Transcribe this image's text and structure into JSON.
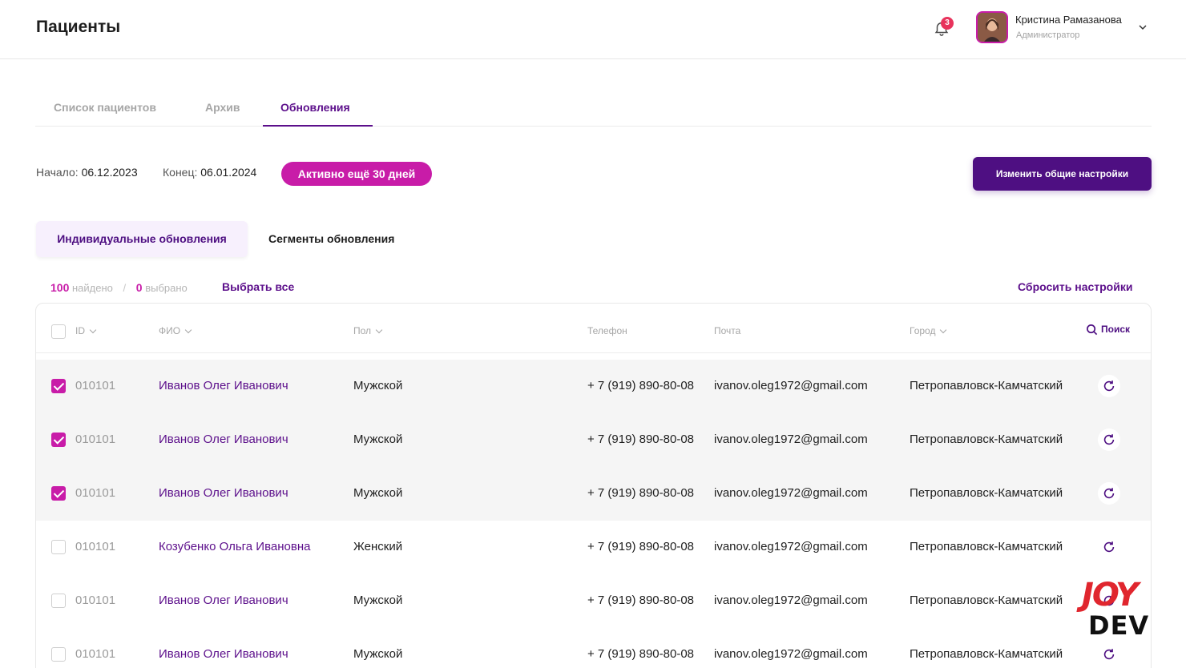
{
  "header": {
    "title": "Пациенты",
    "notifications_count": "3",
    "user": {
      "name": "Кристина Рамазанова",
      "role": "Администратор"
    }
  },
  "tabs": [
    {
      "label": "Список пациентов"
    },
    {
      "label": "Архив"
    },
    {
      "label": "Обновления"
    }
  ],
  "period": {
    "start_label": "Начало:",
    "start_value": "06.12.2023",
    "end_label": "Конец:",
    "end_value": "06.01.2024",
    "badge": "Активно ещё 30 дней",
    "settings_button": "Изменить общие настройки"
  },
  "subtabs": [
    {
      "label": "Индивидуальные обновления"
    },
    {
      "label": "Сегменты обновления"
    }
  ],
  "counts": {
    "found_num": "100",
    "found_label": "найдено",
    "separator": "/",
    "selected_num": "0",
    "selected_label": "выбрано",
    "select_all": "Выбрать все",
    "reset": "Сбросить настройки"
  },
  "table": {
    "columns": {
      "id": "ID",
      "name": "ФИО",
      "sex": "Пол",
      "phone": "Телефон",
      "mail": "Почта",
      "city": "Город",
      "search": "Поиск"
    },
    "rows": [
      {
        "checked": true,
        "id": "010101",
        "name": "Иванов Олег Иванович",
        "sex": "Мужской",
        "phone": "+ 7 (919) 890-80-08",
        "mail": "ivanov.oleg1972@gmail.com",
        "city": "Петропавловск-Камчатский"
      },
      {
        "checked": true,
        "id": "010101",
        "name": "Иванов Олег Иванович",
        "sex": "Мужской",
        "phone": "+ 7 (919) 890-80-08",
        "mail": "ivanov.oleg1972@gmail.com",
        "city": "Петропавловск-Камчатский"
      },
      {
        "checked": true,
        "id": "010101",
        "name": "Иванов Олег Иванович",
        "sex": "Мужской",
        "phone": "+ 7 (919) 890-80-08",
        "mail": "ivanov.oleg1972@gmail.com",
        "city": "Петропавловск-Камчатский"
      },
      {
        "checked": false,
        "id": "010101",
        "name": "Козубенко Ольга Ивановна",
        "sex": "Женский",
        "phone": "+ 7 (919) 890-80-08",
        "mail": "ivanov.oleg1972@gmail.com",
        "city": "Петропавловск-Камчатский"
      },
      {
        "checked": false,
        "id": "010101",
        "name": "Иванов Олег Иванович",
        "sex": "Мужской",
        "phone": "+ 7 (919) 890-80-08",
        "mail": "ivanov.oleg1972@gmail.com",
        "city": "Петропавловск-Камчатский"
      },
      {
        "checked": false,
        "id": "010101",
        "name": "Иванов Олег Иванович",
        "sex": "Мужской",
        "phone": "+ 7 (919) 890-80-08",
        "mail": "ivanov.oleg1972@gmail.com",
        "city": "Петропавловск-Камчатский"
      }
    ]
  },
  "logo": {
    "top": "JOY",
    "bottom": "DEV"
  },
  "colors": {
    "primary": "#4e0f82",
    "accent": "#c81ca8",
    "badge": "#e8335c"
  }
}
